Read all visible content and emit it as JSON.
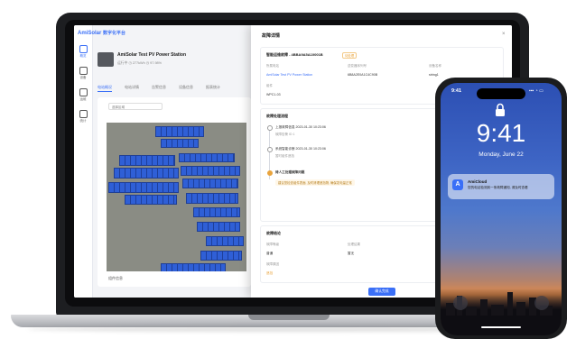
{
  "app": {
    "brand": "AmiSolar",
    "brand_suffix": "数字化平台"
  },
  "sidebar": {
    "items": [
      {
        "label": "概览",
        "icon": "dashboard-icon",
        "active": true
      },
      {
        "label": "设备",
        "icon": "device-icon"
      },
      {
        "label": "运维",
        "icon": "maintenance-icon"
      },
      {
        "label": "统计",
        "icon": "statistics-icon"
      }
    ]
  },
  "station": {
    "name": "AmiSolar Test PV Power Station",
    "meta": "运行中    ◷ 277kWh    ◷ 97.98%"
  },
  "tabs": [
    "电站概况",
    "电站详情",
    "告警信息",
    "设备信息",
    "报表统计"
  ],
  "map": {
    "select_placeholder": "选择区域",
    "footer": "组件信息"
  },
  "dialog": {
    "title": "故障详情",
    "close": "×",
    "fault_section": {
      "title": "智能运维故障 - 4BBA9A5A10001B",
      "tag": "待处理",
      "labels": [
        "所属电站",
        "逆变器序列号",
        "设备名称",
        "组件"
      ],
      "values": [
        "AmiSolar Test PV Power Station",
        "6B8A2E0A1C4C90B",
        "string1",
        "WPC1-03"
      ]
    },
    "timeline_section": {
      "title": "故障处理流程",
      "events": [
        {
          "title": "上报故障信息 2023-01-30 10:23:06",
          "detail": "故障告警 ID 1"
        },
        {
          "title": "系统智能诊断 2023-01-30 10:23:06",
          "detail": "暂时组件遮挡"
        },
        {
          "title": "待人工处理故障问题",
          "detail": ""
        }
      ],
      "alert": "建议您检查组件表面, 及时清理遮挡物, 确保发电量正常"
    },
    "result_section": {
      "title": "故障结论",
      "labels": [
        "故障等级",
        "处理结果",
        "故障原因"
      ],
      "values": [
        "普通",
        "暂无",
        "遮挡"
      ]
    },
    "confirm": "确认完成"
  },
  "phone": {
    "status_time": "9:41",
    "status_right": "▪▪▪ ◔ ▭",
    "clock": "9:41",
    "date": "Monday, June 22",
    "notification": {
      "app": "AmiCloud",
      "icon_letter": "A",
      "body": "您的电站检测到一条故障通知, 请及时查看"
    }
  },
  "colors": {
    "accent": "#3a6ff7",
    "warning": "#e9a43d",
    "solar_panel": "#2a57c9"
  }
}
